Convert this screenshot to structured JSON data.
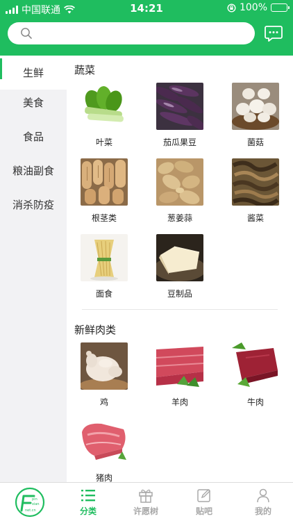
{
  "status_bar": {
    "carrier": "中国联通",
    "time": "14:21",
    "battery": "100%"
  },
  "search": {
    "placeholder": ""
  },
  "colors": {
    "accent": "#1fbd5f",
    "sidebar_bg": "#f2f2f4",
    "inactive_tab": "#a8a8a8"
  },
  "sidebar": {
    "items": [
      {
        "label": "生鲜",
        "active": true
      },
      {
        "label": "美食",
        "active": false
      },
      {
        "label": "食品",
        "active": false
      },
      {
        "label": "粮油副食",
        "active": false
      },
      {
        "label": "消杀防疫",
        "active": false
      }
    ]
  },
  "sections": [
    {
      "title": "蔬菜",
      "items": [
        {
          "label": "叶菜",
          "icon": "leafy-greens-image"
        },
        {
          "label": "茄瓜果豆",
          "icon": "eggplant-image"
        },
        {
          "label": "菌菇",
          "icon": "mushroom-image"
        },
        {
          "label": "根茎类",
          "icon": "lotus-root-image"
        },
        {
          "label": "葱姜蒜",
          "icon": "ginger-image"
        },
        {
          "label": "酱菜",
          "icon": "pickles-image"
        },
        {
          "label": "面食",
          "icon": "noodles-image"
        },
        {
          "label": "豆制品",
          "icon": "tofu-image"
        }
      ]
    },
    {
      "title": "新鲜肉类",
      "items": [
        {
          "label": "鸡",
          "icon": "chicken-image"
        },
        {
          "label": "羊肉",
          "icon": "mutton-image"
        },
        {
          "label": "牛肉",
          "icon": "beef-image"
        },
        {
          "label": "猪肉",
          "icon": "pork-image"
        }
      ]
    }
  ],
  "tabbar": {
    "logo_text": [
      "pin",
      "xian",
      "net.cn"
    ],
    "tabs": [
      {
        "label": "分类",
        "icon": "list-icon",
        "active": true
      },
      {
        "label": "许愿树",
        "icon": "gift-icon",
        "active": false
      },
      {
        "label": "贴吧",
        "icon": "edit-icon",
        "active": false
      },
      {
        "label": "我的",
        "icon": "user-icon",
        "active": false
      }
    ]
  }
}
